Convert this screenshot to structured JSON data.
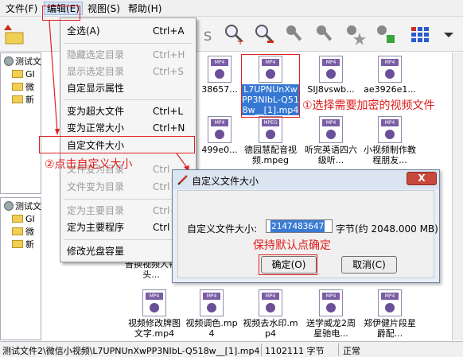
{
  "menubar": {
    "file": "文件(F)",
    "edit": "编辑(E)",
    "view": "视图(S)",
    "help": "帮助(H)"
  },
  "edit_menu": {
    "items": [
      {
        "label": "全选(A)",
        "shortcut": "Ctrl+A",
        "enabled": true
      },
      {
        "label": "隐藏选定目录",
        "shortcut": "Ctrl+H",
        "enabled": false
      },
      {
        "label": "显示选定目录",
        "shortcut": "Ctrl+S",
        "enabled": false
      },
      {
        "label": "自定显示属性",
        "shortcut": "",
        "enabled": true
      },
      {
        "label": "变为超大文件",
        "shortcut": "Ctrl+L",
        "enabled": true
      },
      {
        "label": "变为正常大小",
        "shortcut": "Ctrl+N",
        "enabled": true
      },
      {
        "label": "自定文件大小",
        "shortcut": "",
        "enabled": true
      },
      {
        "label": "文件变为目录",
        "shortcut": "Ctrl",
        "enabled": false
      },
      {
        "label": "文件变为目录",
        "shortcut": "Ctrl",
        "enabled": false
      },
      {
        "label": "定为主要目录",
        "shortcut": "Ctrl+",
        "enabled": false
      },
      {
        "label": "定为主要程序",
        "shortcut": "Ctrl",
        "enabled": true
      },
      {
        "label": "修改光盘容量",
        "shortcut": "",
        "enabled": true
      }
    ]
  },
  "tree_top": [
    {
      "label": "测试文",
      "type": "disk"
    },
    {
      "label": "GI",
      "type": "folder"
    },
    {
      "label": "微",
      "type": "folder"
    },
    {
      "label": "新",
      "type": "folder"
    }
  ],
  "tree_bottom": [
    {
      "label": "测试文",
      "type": "disk"
    },
    {
      "label": "GI",
      "type": "folder"
    },
    {
      "label": "微",
      "type": "folder"
    },
    {
      "label": "新",
      "type": "folder"
    }
  ],
  "files": [
    {
      "name": "38657...",
      "tag": "MP4"
    },
    {
      "name": "L7UPNUnXwPP3NIbL-Q518w__[1].mp4",
      "tag": "MP4",
      "selected": true
    },
    {
      "name": "SIJ8vswb...",
      "tag": "MP4"
    },
    {
      "name": "ae3926e1...",
      "tag": "MP4"
    },
    {
      "name": "499e0...",
      "tag": "MP4"
    },
    {
      "name": "德园慧配音视频.mpeg",
      "tag": "MPEG"
    },
    {
      "name": "听完英语四六级听...",
      "tag": "MP4"
    },
    {
      "name": "小视频制作教程朋友...",
      "tag": "MP4"
    },
    {
      "name": "普换视频人物头...",
      "tag": "MP4"
    },
    {
      "name": "视频修改牌图文字.mp4",
      "tag": "MP4"
    },
    {
      "name": "视频调色.mp4",
      "tag": "MP4"
    },
    {
      "name": "视频去水印.mp4",
      "tag": "MP4"
    },
    {
      "name": "送学威龙2周星驰电...",
      "tag": "MP4"
    },
    {
      "name": "郑伊健片段星爵配...",
      "tag": "MP4"
    }
  ],
  "dialog": {
    "title": "自定义文件大小",
    "close": "X",
    "size_label": "自定义文件大小:",
    "size_value": "2147483647",
    "size_unit": "字节(约 2048.000 MB)",
    "ok": "确定(O)",
    "cancel": "取消(C)"
  },
  "annotations": {
    "step1": "①选择需要加密的视频文件",
    "step2": "②点击自定义大小",
    "keep_default": "保持默认点确定"
  },
  "status": {
    "path": "测试文件2\\微信小视频\\L7UPNUnXwPP3NIbL-Q518w__[1].mp4",
    "size": "1102111 字节",
    "state": "正常"
  },
  "colors": {
    "accent": "#e02020",
    "selection": "#3578d4",
    "video_tag": "#7b5da6"
  }
}
